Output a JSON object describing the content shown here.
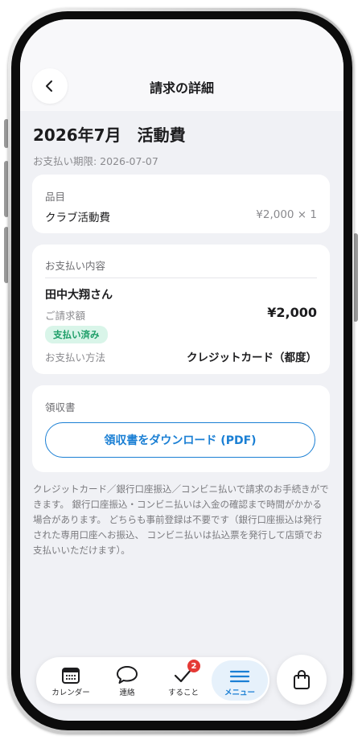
{
  "header": {
    "title": "請求の詳細",
    "back_icon": "chevron-left-icon"
  },
  "invoice": {
    "title": "2026年7月　活動費",
    "due": "お支払い期限: 2026-07-07"
  },
  "items_card": {
    "label": "品目",
    "item_name": "クラブ活動費",
    "item_price": "¥2,000 × 1"
  },
  "payment_card": {
    "label": "お支払い内容",
    "payer": "田中大翔さん",
    "amount_label": "ご請求額",
    "amount": "¥2,000",
    "status_badge": "支払い済み",
    "status_color": "#1e9e68",
    "method_label": "お支払い方法",
    "method": "クレジットカード（都度）"
  },
  "receipt_card": {
    "label": "領収書",
    "download_label": "領収書をダウンロード (PDF)"
  },
  "note": "クレジットカード／銀行口座振込／コンビニ払いで請求のお手続きができます。 銀行口座振込・コンビニ払いは入金の確認まで時間がかかる場合があります。 どちらも事前登録は不要です（銀行口座振込は発行された専用口座へお振込、 コンビニ払いは払込票を発行して店頭でお支払いいただけます）。",
  "nav": {
    "items": [
      {
        "label": "カレンダー",
        "icon": "calendar-icon"
      },
      {
        "label": "連絡",
        "icon": "chat-bubble-icon"
      },
      {
        "label": "すること",
        "icon": "checkmark-icon",
        "badge": "2"
      },
      {
        "label": "メニュー",
        "icon": "menu-icon",
        "active": true
      }
    ],
    "bag_icon": "shopping-bag-icon"
  },
  "colors": {
    "accent": "#1a7fd4",
    "badge_red": "#e53935",
    "paid_bg": "#d9f5e9"
  }
}
